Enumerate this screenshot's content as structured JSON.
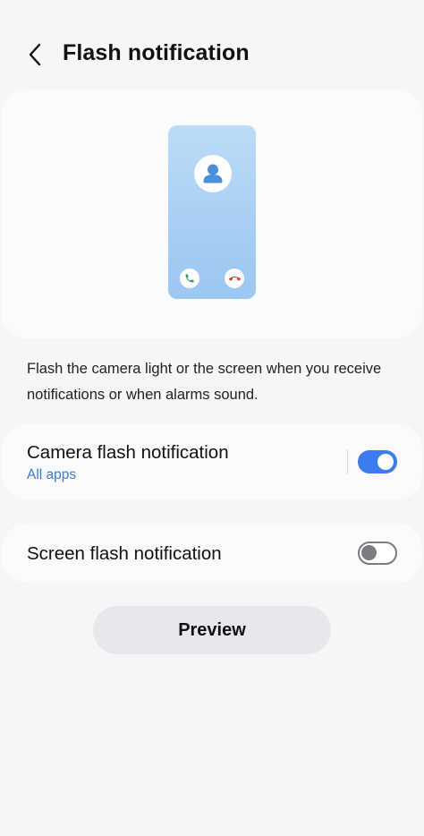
{
  "header": {
    "title": "Flash notification",
    "back_icon": "chevron-left-icon"
  },
  "illustration": {
    "icons": [
      "person-icon",
      "phone-accept-icon",
      "phone-decline-icon"
    ],
    "colors": {
      "screen_top": "#bcdcf7",
      "screen_bottom": "#9cc7f1",
      "accept": "#2e9a5a",
      "decline": "#d9342b"
    }
  },
  "description": "Flash the camera light or the screen when you receive notifications or when alarms sound.",
  "settings": {
    "camera": {
      "title": "Camera flash notification",
      "subtitle": "All apps",
      "enabled": true
    },
    "screen": {
      "title": "Screen flash notification",
      "enabled": false
    }
  },
  "preview_button": {
    "label": "Preview"
  },
  "colors": {
    "accent": "#3c7cf0",
    "link": "#3a78c9",
    "background": "#f6f6f8",
    "card": "#fbfbfd"
  }
}
